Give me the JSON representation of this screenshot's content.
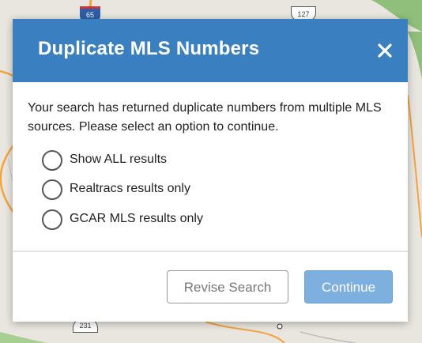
{
  "map": {
    "shields": [
      "65",
      "127",
      "231"
    ],
    "colors": {
      "background": "#e9e6df",
      "road": "#f4a340",
      "green": "#8fbf7a"
    }
  },
  "dialog": {
    "title": "Duplicate MLS Numbers",
    "close_icon": "close-icon",
    "message": "Your search has returned duplicate numbers from multiple MLS sources. Please select an option to continue.",
    "options": [
      {
        "label": "Show ALL results",
        "selected": false
      },
      {
        "label": "Realtracs results only",
        "selected": false
      },
      {
        "label": "GCAR MLS results only",
        "selected": false
      }
    ],
    "buttons": {
      "revise": "Revise Search",
      "continue": "Continue"
    },
    "colors": {
      "header": "#3a7fbf",
      "continue_button": "#7db0de"
    }
  }
}
